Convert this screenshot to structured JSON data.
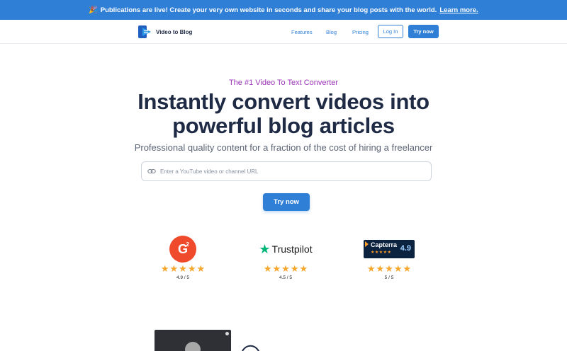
{
  "banner": {
    "emoji": "🎉",
    "text": "Publications are live! Create your very own website in seconds and share your blog posts with the world.",
    "link": "Learn more."
  },
  "nav": {
    "brand": "Video to Blog",
    "links": [
      "Features",
      "Blog",
      "Pricing"
    ],
    "login": "Log In",
    "try_now": "Try now"
  },
  "hero": {
    "eyebrow": "The #1 Video To Text Converter",
    "headline_line1": "Instantly convert videos into",
    "headline_line2": "powerful blog articles",
    "subhead": "Professional quality content for a fraction of the cost of hiring a freelancer",
    "input_placeholder": "Enter a YouTube video or channel URL",
    "cta": "Try now"
  },
  "ratings": [
    {
      "source": "G2",
      "logo_icon": "g2-logo-icon",
      "score": "4.9 / 5",
      "stars": 5
    },
    {
      "source": "Trustpilot",
      "logo_icon": "trustpilot-logo-icon",
      "score": "4.5 / 5",
      "stars": 5
    },
    {
      "source": "Capterra",
      "logo_icon": "capterra-logo-icon",
      "badge_score": "4.9",
      "score": "5 / 5",
      "stars": 5
    }
  ],
  "colors": {
    "brand_blue": "#2f7fd6",
    "eyebrow_purple": "#9b35b8",
    "heading": "#1f2a44",
    "star": "#f4a62a",
    "g2_red": "#ef4a2b",
    "trustpilot_green": "#00b67a",
    "capterra_navy": "#0c2340"
  }
}
